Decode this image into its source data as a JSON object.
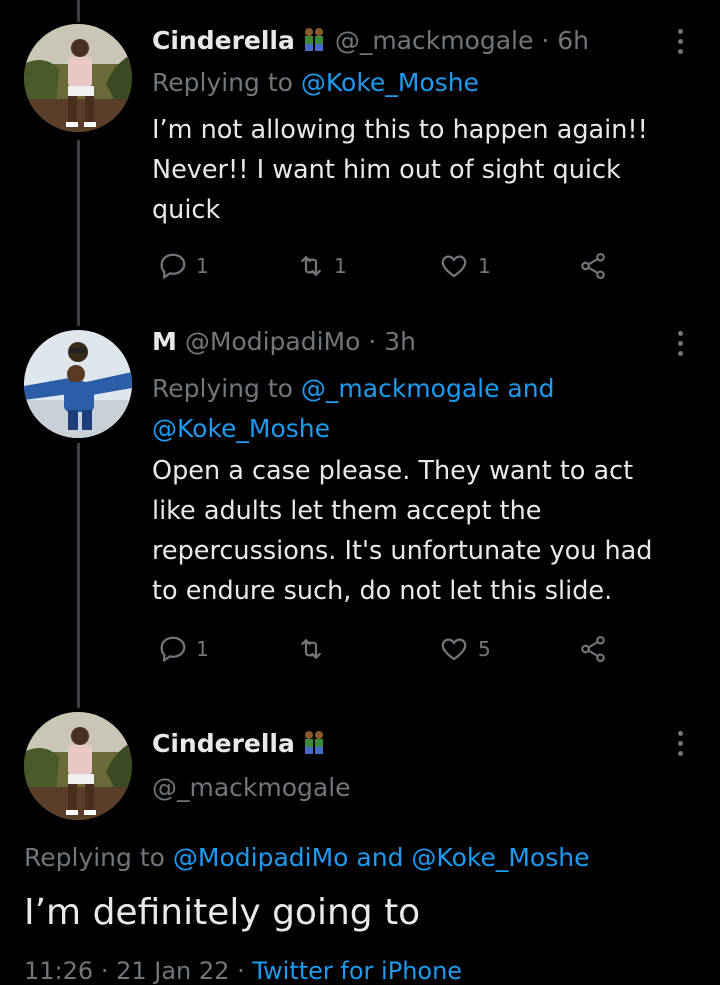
{
  "tweets": [
    {
      "name": "Cinderella",
      "handle": "@_mackmogale",
      "time": "6h",
      "replying_prefix": "Replying to",
      "replying_to": "@Koke_Moshe",
      "text_lines": [
        "I’m not allowing this to happen again!!",
        "Never!! I want him out of sight quick",
        "quick"
      ],
      "replies": "1",
      "retweets": "1",
      "likes": "1"
    },
    {
      "name": "M",
      "handle": "@ModipadiMo",
      "time": "3h",
      "replying_prefix": "Replying to",
      "replying_to_1": "@_mackmogale",
      "replying_and": "and",
      "replying_to_2": "@Koke_Moshe",
      "text_lines": [
        "Open a case please. They want to act",
        "like adults let them accept the",
        "repercussions. It's unfortunate you had",
        "to endure such, do not let this slide."
      ],
      "replies": "1",
      "retweets": "",
      "likes": "5"
    }
  ],
  "main_tweet": {
    "name": "Cinderella",
    "handle": "@_mackmogale",
    "replying_prefix": "Replying to",
    "replying_to_1": "@ModipadiMo",
    "replying_and": "and",
    "replying_to_2": "@Koke_Moshe",
    "text": "I’m definitely going to",
    "time": "11:26",
    "date": "21 Jan 22",
    "source": "Twitter for iPhone"
  },
  "icons": {
    "reply": "reply-icon",
    "retweet": "retweet-icon",
    "like": "heart-icon",
    "share": "share-icon",
    "more": "more-vertical-icon",
    "emoji": "people-holding-hands-emoji"
  },
  "colors": {
    "background": "#000000",
    "text": "#e7e9ea",
    "muted": "#71767b",
    "link": "#1d9bf0"
  }
}
